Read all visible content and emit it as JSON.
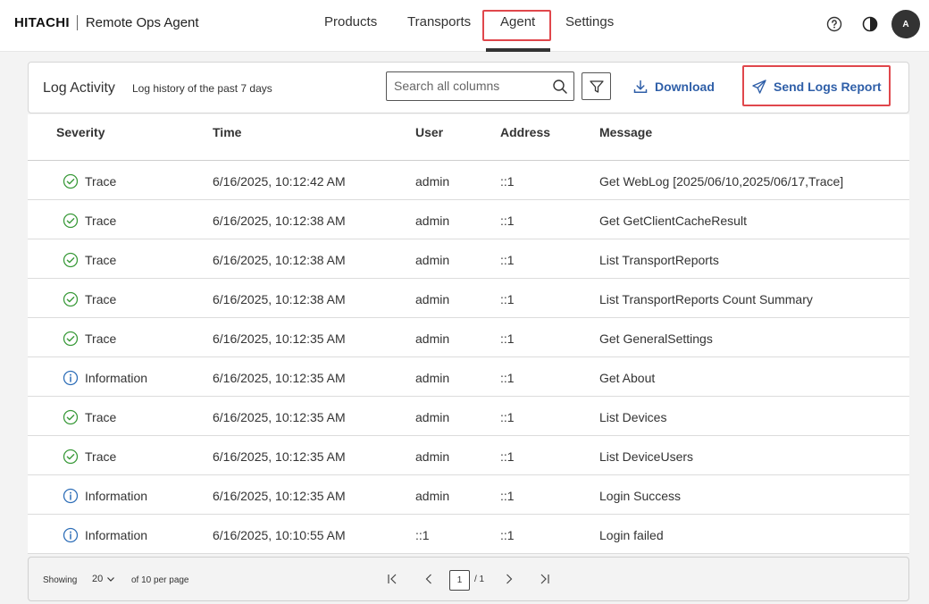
{
  "header": {
    "logo": "HITACHI",
    "app_name": "Remote Ops Agent",
    "nav": [
      "Products",
      "Transports",
      "Agent",
      "Settings"
    ],
    "active_nav": "Agent",
    "avatar_initial": "A",
    "icons": [
      "help-circle-icon",
      "contrast-icon"
    ]
  },
  "log_card": {
    "title": "Log Activity",
    "subtitle": "Log history of the past 7 days",
    "search_placeholder": "Search all columns",
    "download_label": "Download",
    "send_label": "Send Logs Report"
  },
  "table": {
    "columns": [
      "Severity",
      "Time",
      "User",
      "Address",
      "Message"
    ],
    "rows": [
      {
        "severity": "Trace",
        "time": "6/16/2025, 10:12:42 AM",
        "user": "admin",
        "address": "::1",
        "message": "Get WebLog [2025/06/10,2025/06/17,Trace]"
      },
      {
        "severity": "Trace",
        "time": "6/16/2025, 10:12:38 AM",
        "user": "admin",
        "address": "::1",
        "message": "Get GetClientCacheResult"
      },
      {
        "severity": "Trace",
        "time": "6/16/2025, 10:12:38 AM",
        "user": "admin",
        "address": "::1",
        "message": "List TransportReports"
      },
      {
        "severity": "Trace",
        "time": "6/16/2025, 10:12:38 AM",
        "user": "admin",
        "address": "::1",
        "message": "List TransportReports Count Summary"
      },
      {
        "severity": "Trace",
        "time": "6/16/2025, 10:12:35 AM",
        "user": "admin",
        "address": "::1",
        "message": "Get GeneralSettings"
      },
      {
        "severity": "Information",
        "time": "6/16/2025, 10:12:35 AM",
        "user": "admin",
        "address": "::1",
        "message": "Get About"
      },
      {
        "severity": "Trace",
        "time": "6/16/2025, 10:12:35 AM",
        "user": "admin",
        "address": "::1",
        "message": "List Devices"
      },
      {
        "severity": "Trace",
        "time": "6/16/2025, 10:12:35 AM",
        "user": "admin",
        "address": "::1",
        "message": "List DeviceUsers"
      },
      {
        "severity": "Information",
        "time": "6/16/2025, 10:12:35 AM",
        "user": "admin",
        "address": "::1",
        "message": "Login Success"
      },
      {
        "severity": "Information",
        "time": "6/16/2025, 10:10:55 AM",
        "user": "::1",
        "address": "::1",
        "message": "Login failed"
      }
    ]
  },
  "pagination": {
    "showing_label": "Showing",
    "page_size": "20",
    "per_page_label": "of 10 per page",
    "current_page": "1",
    "total_pages": "/ 1"
  },
  "colors": {
    "accent_blue": "#2f5fa8",
    "trace_green": "#3a9a3a",
    "info_blue": "#2f6fb8",
    "highlight_red": "#e0474c"
  }
}
